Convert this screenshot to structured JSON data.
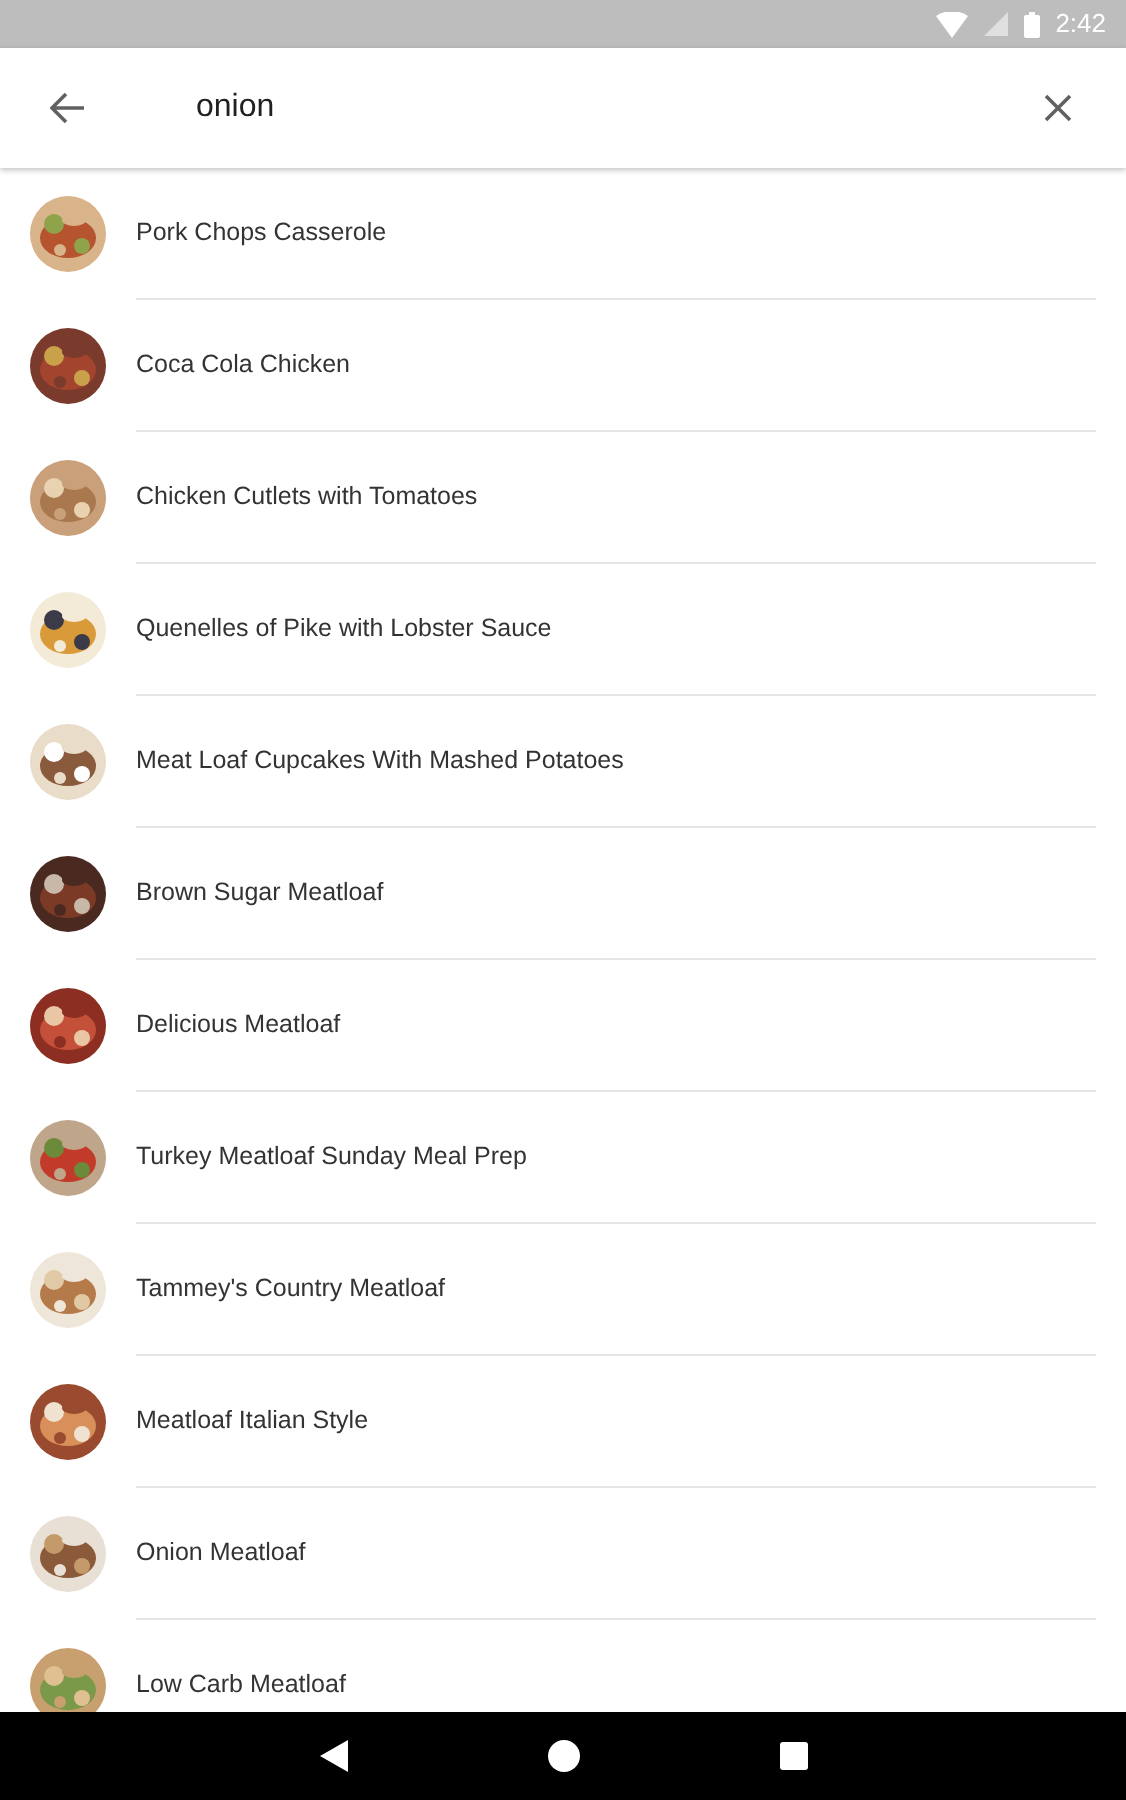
{
  "status_bar": {
    "time": "2:42"
  },
  "search": {
    "value": "onion"
  },
  "results": [
    {
      "title": "Pork Chops Casserole"
    },
    {
      "title": "Coca Cola Chicken"
    },
    {
      "title": "Chicken Cutlets with Tomatoes"
    },
    {
      "title": "Quenelles of Pike with Lobster Sauce"
    },
    {
      "title": "Meat Loaf Cupcakes With Mashed Potatoes"
    },
    {
      "title": "Brown Sugar Meatloaf"
    },
    {
      "title": "Delicious Meatloaf"
    },
    {
      "title": "Turkey Meatloaf Sunday Meal Prep"
    },
    {
      "title": "Tammey's Country Meatloaf"
    },
    {
      "title": "Meatloaf Italian Style"
    },
    {
      "title": "Onion Meatloaf"
    },
    {
      "title": "Low Carb Meatloaf"
    }
  ]
}
